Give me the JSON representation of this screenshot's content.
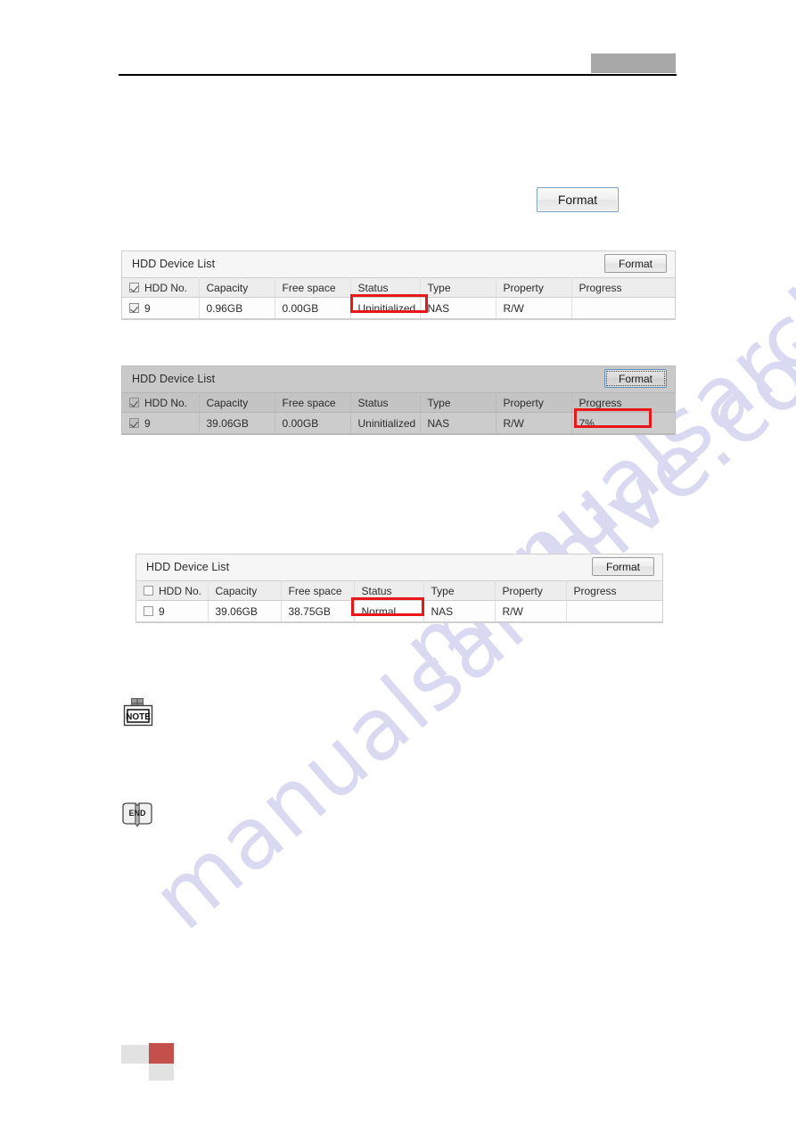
{
  "page": {
    "watermark_text": "manualsarchive.com",
    "header_block_color": "#a8a8a8",
    "annotation_color": "#e8171a"
  },
  "standalone_button": {
    "label": "Format",
    "name": "format-button"
  },
  "panels": [
    {
      "id": "panel-1",
      "title": "HDD Device List",
      "format_label": "Format",
      "state": "enabled",
      "select_all_checked": true,
      "columns": [
        "HDD No.",
        "Capacity",
        "Free space",
        "Status",
        "Type",
        "Property",
        "Progress"
      ],
      "rows": [
        {
          "checked": true,
          "hdd_no": "9",
          "capacity": "0.96GB",
          "free_space": "0.00GB",
          "status": "Uninitialized",
          "type": "NAS",
          "property": "R/W",
          "progress": ""
        }
      ],
      "highlight": "status"
    },
    {
      "id": "panel-2",
      "title": "HDD Device List",
      "format_label": "Format",
      "state": "disabled",
      "select_all_checked": true,
      "columns": [
        "HDD No.",
        "Capacity",
        "Free space",
        "Status",
        "Type",
        "Property",
        "Progress"
      ],
      "rows": [
        {
          "checked": true,
          "hdd_no": "9",
          "capacity": "39.06GB",
          "free_space": "0.00GB",
          "status": "Uninitialized",
          "type": "NAS",
          "property": "R/W",
          "progress": "7%"
        }
      ],
      "highlight": "progress"
    },
    {
      "id": "panel-3",
      "title": "HDD Device List",
      "format_label": "Format",
      "state": "enabled",
      "select_all_checked": false,
      "columns": [
        "HDD No.",
        "Capacity",
        "Free space",
        "Status",
        "Type",
        "Property",
        "Progress"
      ],
      "rows": [
        {
          "checked": false,
          "hdd_no": "9",
          "capacity": "39.06GB",
          "free_space": "38.75GB",
          "status": "Normal",
          "type": "NAS",
          "property": "R/W",
          "progress": ""
        }
      ],
      "highlight": "status"
    }
  ],
  "callouts": {
    "note_label": "NOTE",
    "end_label": "END"
  },
  "footer": {
    "block_gray_left_color": "#e2e2e2",
    "block_red_color": "#c4504b",
    "block_gray_bottom_color": "#e2e2e2"
  }
}
